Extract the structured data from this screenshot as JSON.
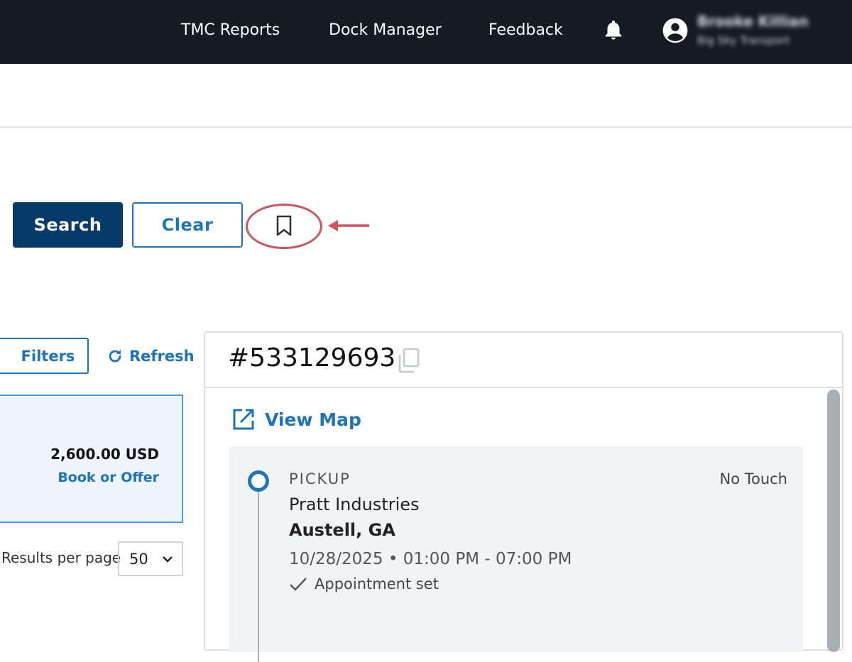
{
  "nav": {
    "items": [
      "TMC Reports",
      "Dock Manager",
      "Feedback"
    ],
    "icons": {
      "notifications": "bell-icon",
      "account": "user-circle-icon"
    }
  },
  "user": {
    "name": "Brooke Killian",
    "org": "Big Sky Transport"
  },
  "search_actions": {
    "search_label": "Search",
    "clear_label": "Clear",
    "bookmark_icon": "bookmark-icon"
  },
  "annotation": {
    "color": "#c9575e",
    "shape": "circle-with-arrow"
  },
  "results": {
    "filters_label": "Filters",
    "refresh_label": "Refresh",
    "card": {
      "price": "2,600.00 USD",
      "action": "Book or Offer"
    },
    "per_page_label": "Results per page",
    "per_page_value": "50"
  },
  "detail": {
    "load_id": "#533129693",
    "view_map_label": "View Map",
    "stop": {
      "type": "PICKUP",
      "touch": "No Touch",
      "facility": "Pratt Industries",
      "city": "Austell, GA",
      "window": "10/28/2025 • 01:00 PM - 07:00 PM",
      "appointment": "Appointment set"
    }
  },
  "colors": {
    "topbar": "#141b24",
    "primary": "#073a6b",
    "link": "#1f73b7",
    "card_bg": "#edf4fc",
    "panel_bg": "#f2f3f5"
  }
}
